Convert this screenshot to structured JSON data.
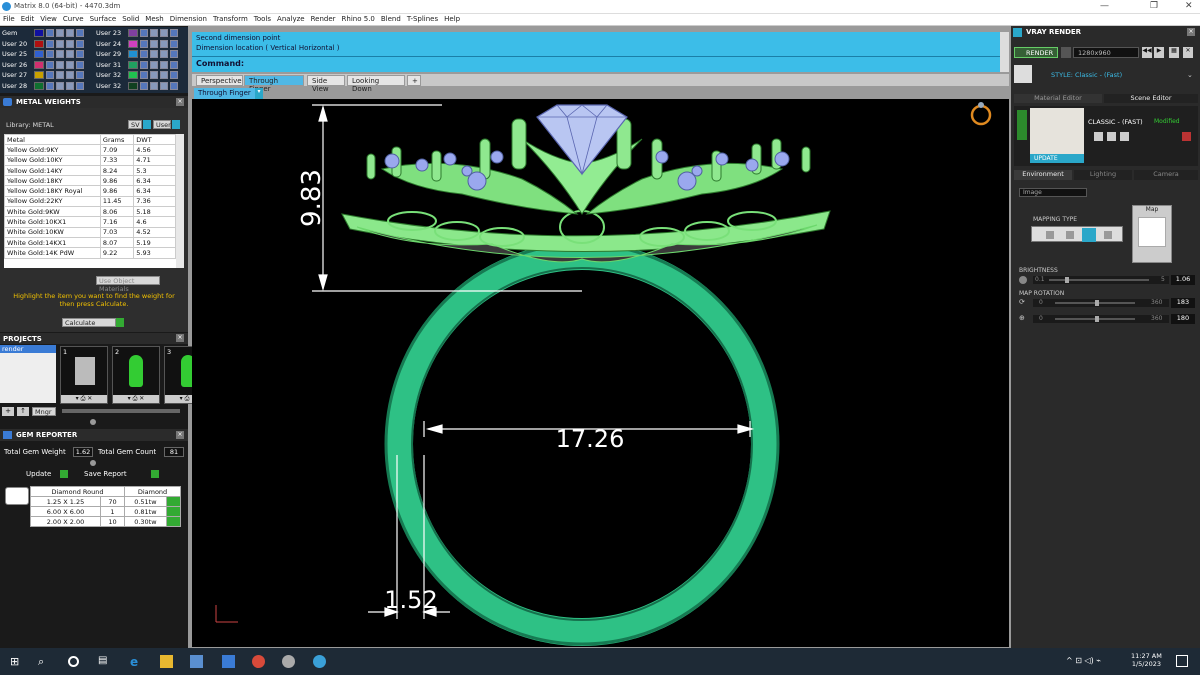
{
  "window": {
    "title": "Matrix 8.0 (64-bit) - 4470.3dm"
  },
  "menu": [
    "File",
    "Edit",
    "View",
    "Curve",
    "Surface",
    "Solid",
    "Mesh",
    "Dimension",
    "Transform",
    "Tools",
    "Analyze",
    "Render",
    "Rhino 5.0",
    "Blend",
    "T-Splines",
    "Help"
  ],
  "gems": {
    "left": [
      "Gem",
      "User 20",
      "User 25",
      "User 26",
      "User 27",
      "User 28"
    ],
    "right": [
      "User 23",
      "User 24",
      "User 29",
      "User 31",
      "User 32",
      "User 32"
    ],
    "colors_left": [
      "#1010a0",
      "#b01010",
      "#3060d0",
      "#d03070",
      "#c8a000",
      "#107030"
    ],
    "colors_right": [
      "#8040a0",
      "#d040c0",
      "#2090d0",
      "#20a060",
      "#20c050",
      "#104020"
    ]
  },
  "metal_weights": {
    "title": "METAL WEIGHTS",
    "library": "Library: METAL",
    "toggles": [
      "SV",
      "User"
    ],
    "headers": [
      "Metal",
      "Grams",
      "DWT"
    ],
    "rows": [
      [
        "Yellow Gold:9KY",
        "7.09",
        "4.56"
      ],
      [
        "Yellow Gold:10KY",
        "7.33",
        "4.71"
      ],
      [
        "Yellow Gold:14KY",
        "8.24",
        "5.3"
      ],
      [
        "Yellow Gold:18KY",
        "9.86",
        "6.34"
      ],
      [
        "Yellow Gold:18KY Royal",
        "9.86",
        "6.34"
      ],
      [
        "Yellow Gold:22KY",
        "11.45",
        "7.36"
      ],
      [
        "White Gold:9KW",
        "8.06",
        "5.18"
      ],
      [
        "White Gold:10KX1",
        "7.16",
        "4.6"
      ],
      [
        "White Gold:10KW",
        "7.03",
        "4.52"
      ],
      [
        "White Gold:14KX1",
        "8.07",
        "5.19"
      ],
      [
        "White Gold:14K PdW",
        "9.22",
        "5.93"
      ]
    ],
    "use_obj": "Use Object Materials",
    "hint": "Highlight the item you want to find the weight for then press Calculate.",
    "calc": "Calculate"
  },
  "projects": {
    "title": "PROJECTS",
    "item": "render",
    "thumbs": [
      "1",
      "2",
      "3"
    ],
    "btn": "Mngr"
  },
  "gem_reporter": {
    "title": "GEM REPORTER",
    "tgw_label": "Total Gem Weight",
    "tgw": "1.62",
    "tgc_label": "Total Gem Count",
    "tgc": "81",
    "update": "Update",
    "save": "Save Report",
    "headers": [
      "Diamond Round",
      "Diamond"
    ],
    "rows": [
      [
        "1.25 X 1.25",
        "70",
        "0.51tw"
      ],
      [
        "6.00 X 6.00",
        "1",
        "0.81tw"
      ],
      [
        "2.00 X 2.00",
        "10",
        "0.30tw"
      ]
    ]
  },
  "command": {
    "line1": "Second dimension point",
    "line2": "Dimension location ( Vertical  Horizontal )",
    "prompt": "Command:"
  },
  "tabs": [
    "Perspective",
    "Through Finger",
    "Side View",
    "Looking Down",
    "+"
  ],
  "active_view": "Through Finger",
  "dims": {
    "height": "9.83",
    "width": "17.26",
    "thick": "1.52"
  },
  "vray": {
    "title": "VRAY RENDER",
    "render": "RENDER",
    "res": "1280x960",
    "style": "STYLE: Classic - (Fast)",
    "tabs": [
      "Material Editor",
      "Scene Editor"
    ],
    "classic": "CLASSIC - (FAST)",
    "modified": "Modified",
    "update": "UPDATE",
    "env_tabs": [
      "Environment",
      "Lighting",
      "Camera"
    ],
    "image": "Image",
    "mapping": "MAPPING TYPE",
    "map": "Map",
    "brightness": "BRIGHTNESS",
    "b_min": "0.1",
    "b_max": "5",
    "b_val": "1.06",
    "rotation": "MAP ROTATION",
    "r_min": "0",
    "r_max": "360",
    "r1": "183",
    "r2": "180"
  },
  "taskbar": {
    "time": "11:27 AM",
    "date": "1/5/2023"
  }
}
